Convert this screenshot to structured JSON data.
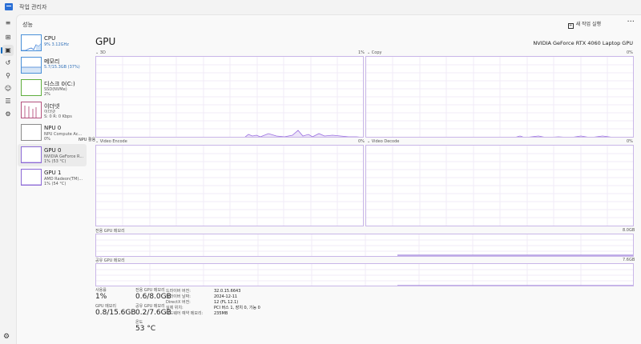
{
  "window": {
    "title": "작업 관리자"
  },
  "header": {
    "page_title": "성능",
    "run_task_label": "새 작업 실행",
    "more_label": "···"
  },
  "rail": [
    {
      "name": "menu-icon",
      "glyph": "≡"
    },
    {
      "name": "processes-icon",
      "glyph": "⊞"
    },
    {
      "name": "performance-icon",
      "glyph": "▣"
    },
    {
      "name": "app-history-icon",
      "glyph": "↺"
    },
    {
      "name": "startup-icon",
      "glyph": "⚲"
    },
    {
      "name": "users-icon",
      "glyph": "☺"
    },
    {
      "name": "details-icon",
      "glyph": "☰"
    },
    {
      "name": "services-icon",
      "glyph": "⚙"
    }
  ],
  "settings_glyph": "⚙",
  "sidebar": {
    "items": [
      {
        "name": "CPU",
        "sub": "9% 3.12GHz",
        "sub2": ""
      },
      {
        "name": "메모리",
        "sub": "5.7/15.3GB (37%)",
        "sub2": ""
      },
      {
        "name": "디스크 0(C:)",
        "sub": "SSD(NVMe)",
        "sub2": "2%"
      },
      {
        "name": "이더넷",
        "sub": "이더넷",
        "sub2": "S: 0 R: 0 Kbps"
      },
      {
        "name": "NPU 0",
        "sub": "NPU Compute Ac...",
        "sub2": "0%"
      },
      {
        "name": "GPU 0",
        "sub": "NVIDIA GeForce R...",
        "sub2": "1% (53 °C)"
      },
      {
        "name": "GPU 1",
        "sub": "AMD Radeon(TM)...",
        "sub2": "1% (54 °C)"
      }
    ],
    "tooltip": "NPU 활용"
  },
  "gpu": {
    "title": "GPU",
    "model": "NVIDIA GeForce RTX 4060 Laptop GPU",
    "graphs": [
      {
        "label": "3D",
        "pct": "1%"
      },
      {
        "label": "Copy",
        "pct": "0%"
      },
      {
        "label": "Video Encode",
        "pct": "0%"
      },
      {
        "label": "Video Decode",
        "pct": "0%"
      }
    ],
    "dedicated": {
      "label": "전용 GPU 메모리",
      "max": "8.0GB"
    },
    "shared": {
      "label": "공유 GPU 메모리",
      "max": "7.6GB"
    }
  },
  "stats": {
    "utilization_label": "사용률",
    "utilization": "1%",
    "gpu_memory_label": "GPU 메모리",
    "gpu_memory": "0.8/15.6GB",
    "dedicated_label": "전용 GPU 메모리",
    "dedicated": "0.6/8.0GB",
    "shared_label": "공유 GPU 메모리",
    "shared": "0.2/7.6GB",
    "temp_label": "온도",
    "temp": "53 °C"
  },
  "info": [
    {
      "key": "드라이버 버전:",
      "val": "32.0.15.6643"
    },
    {
      "key": "드라이버 날짜:",
      "val": "2024-12-11"
    },
    {
      "key": "DirectX 버전:",
      "val": "12 (FL 12.1)"
    },
    {
      "key": "실제 위치:",
      "val": "PCI 버스 1, 장치 0, 기능 0"
    },
    {
      "key": "하드웨어 예약 메모리:",
      "val": "235MB"
    }
  ]
}
